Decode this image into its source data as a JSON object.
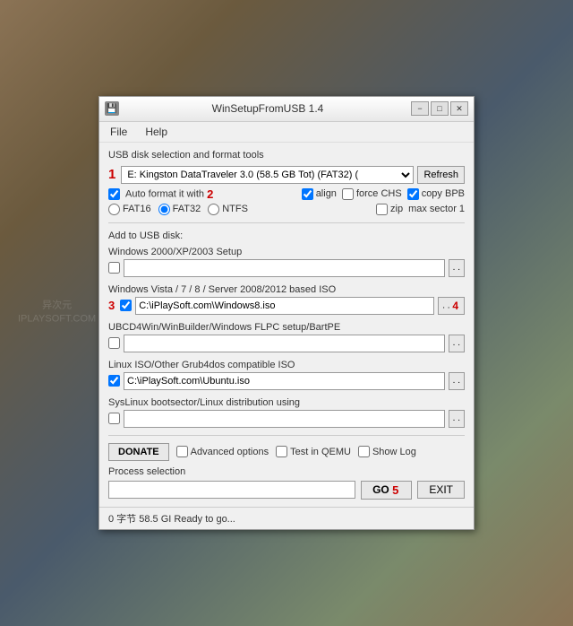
{
  "watermark": {
    "line1": "异次元",
    "line2": "IPLAYSOFT.COM"
  },
  "window": {
    "title": "WinSetupFromUSB 1.4",
    "icon": "💾"
  },
  "titlebar": {
    "minimize": "−",
    "maximize": "□",
    "close": "✕"
  },
  "menu": {
    "file": "File",
    "help": "Help"
  },
  "disk_section": {
    "label": "USB disk selection and format tools",
    "num_label": "1",
    "disk_value": "E: Kingston DataTraveler 3.0 (58.5 GB Tot) (FAT32) (",
    "refresh_label": "Refresh"
  },
  "format": {
    "num_label": "2",
    "auto_format_label": "Auto format it with",
    "auto_format_checked": true,
    "align_checked": true,
    "align_label": "align",
    "force_chs_checked": false,
    "force_chs_label": "force CHS",
    "copy_bpb_checked": true,
    "copy_bpb_label": "copy BPB",
    "fat16_label": "FAT16",
    "fat16_checked": false,
    "fat32_label": "FAT32",
    "fat32_checked": true,
    "ntfs_label": "NTFS",
    "ntfs_checked": false,
    "zip_label": "zip",
    "zip_checked": false,
    "max_sector_label": "max sector",
    "max_sector_value": "1"
  },
  "add_section": {
    "label": "Add to USB disk:"
  },
  "iso_entries": [
    {
      "id": "win2000",
      "title": "Windows 2000/XP/2003 Setup",
      "checked": false,
      "value": "",
      "browse_label": ". ."
    },
    {
      "id": "winvista",
      "title": "Windows Vista / 7 / 8 / Server 2008/2012 based ISO",
      "checked": true,
      "value": "C:\\iPlaySoft.com\\Windows8.iso",
      "browse_label": ". . 4",
      "num_label": "3",
      "browse_num": "4"
    },
    {
      "id": "ubcd",
      "title": "UBCD4Win/WinBuilder/Windows FLPC setup/BartPE",
      "checked": false,
      "value": "",
      "browse_label": ". ."
    },
    {
      "id": "linux",
      "title": "Linux ISO/Other Grub4dos compatible ISO",
      "checked": true,
      "value": "C:\\iPlaySoft.com\\Ubuntu.iso",
      "browse_label": ". ."
    },
    {
      "id": "syslinux",
      "title": "SysLinux bootsector/Linux distribution using",
      "checked": false,
      "value": "",
      "browse_label": ". ."
    }
  ],
  "bottom": {
    "donate_label": "DONATE",
    "advanced_label": "Advanced options",
    "qemu_label": "Test in QEMU",
    "show_log_label": "Show Log",
    "advanced_checked": false,
    "qemu_checked": false,
    "show_log_checked": false
  },
  "process": {
    "label": "Process selection",
    "placeholder": "",
    "go_label": "GO",
    "num_label": "5",
    "exit_label": "EXIT"
  },
  "status": {
    "text": "0 字节  58.5 GI Ready to go..."
  }
}
